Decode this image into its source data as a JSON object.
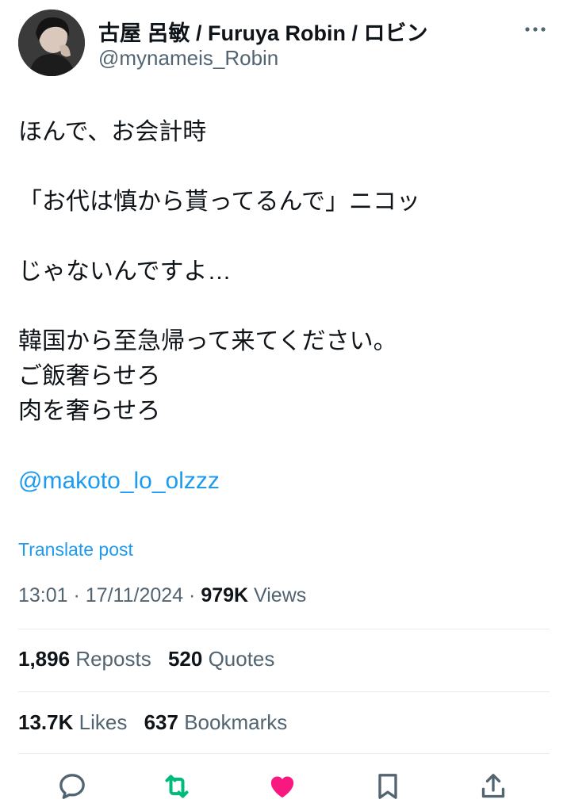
{
  "author": {
    "display_name": "古屋 呂敏 / Furuya Robin / ロビン",
    "handle": "@mynameis_Robin"
  },
  "post": {
    "lines": [
      "ほんで、お会計時",
      "",
      "「お代は慎から貰ってるんで」ニコッ",
      "",
      "じゃないんですよ…",
      "",
      "韓国から至急帰って来てください。",
      "ご飯奢らせろ",
      "肉を奢らせろ",
      ""
    ],
    "mention": "@makoto_lo_olzzz",
    "translate_label": "Translate post"
  },
  "meta": {
    "time": "13:01",
    "date": "17/11/2024",
    "views_count": "979K",
    "views_label": "Views"
  },
  "stats": {
    "reposts_count": "1,896",
    "reposts_label": "Reposts",
    "quotes_count": "520",
    "quotes_label": "Quotes",
    "likes_count": "13.7K",
    "likes_label": "Likes",
    "bookmarks_count": "637",
    "bookmarks_label": "Bookmarks"
  },
  "actions": {
    "icons": [
      "reply-icon",
      "repost-icon",
      "like-icon",
      "bookmark-icon",
      "share-icon"
    ],
    "repost_color": "#00ba7c",
    "like_color": "#f91880",
    "default_color": "#536471"
  }
}
